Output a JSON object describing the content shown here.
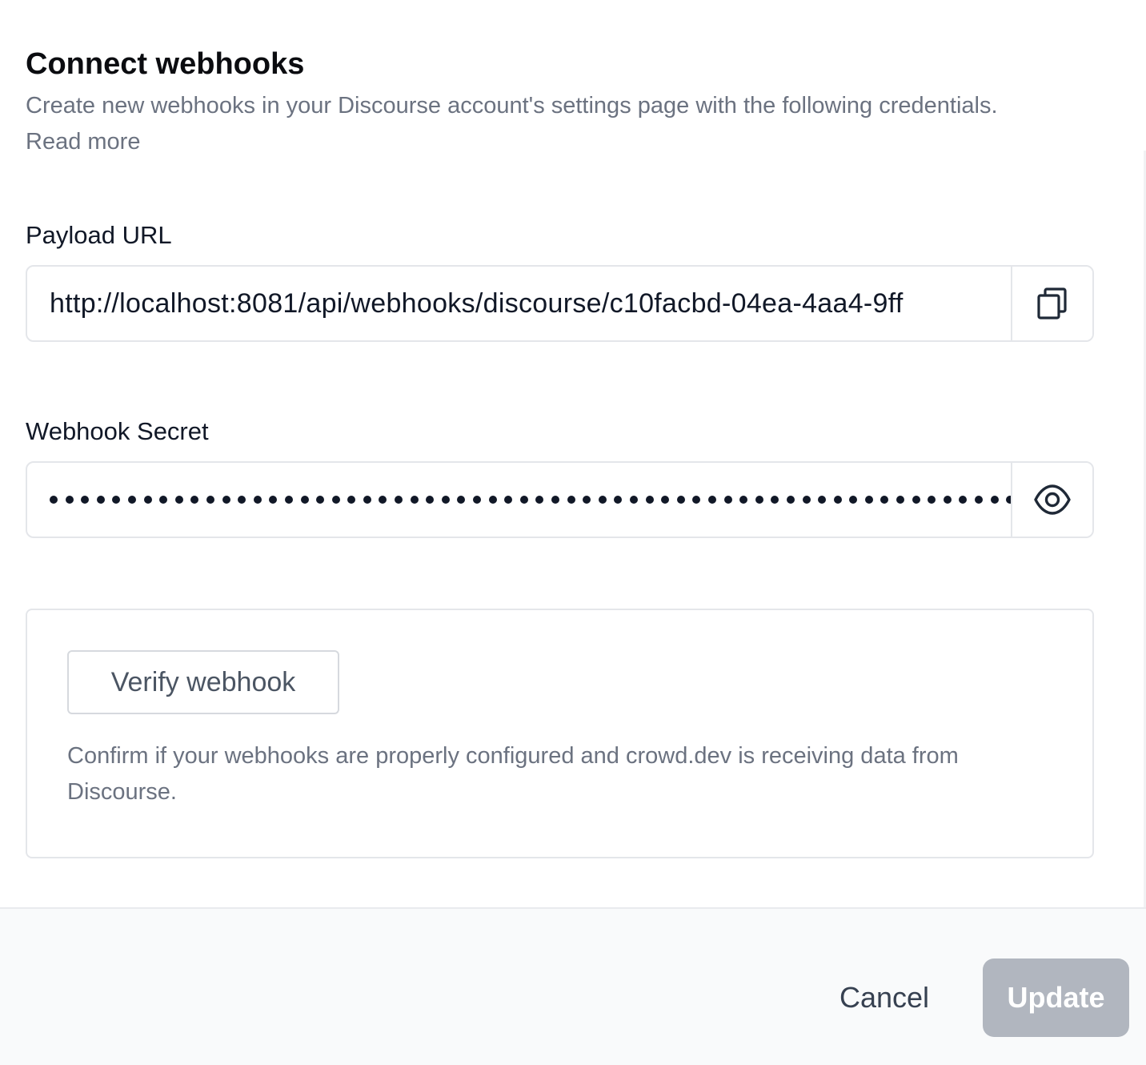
{
  "header": {
    "title": "Connect webhooks",
    "description": "Create new webhooks in your Discourse account's settings page with the following credentials.",
    "read_more": "Read more"
  },
  "payload_url": {
    "label": "Payload URL",
    "value": "http://localhost:8081/api/webhooks/discourse/c10facbd-04ea-4aa4-9ff",
    "copy_icon": "copy-icon"
  },
  "webhook_secret": {
    "label": "Webhook Secret",
    "masked": true,
    "visible_dot_count": 62,
    "toggle_icon": "eye-icon"
  },
  "verify": {
    "button_label": "Verify webhook",
    "help_text": "Confirm if your webhooks are properly configured and crowd.dev is receiving data from Discourse."
  },
  "footer": {
    "cancel_label": "Cancel",
    "update_label": "Update",
    "update_disabled": true
  },
  "colors": {
    "muted_text": "#6b7280",
    "border": "#e4e6ea",
    "footer_bg": "#f9fafb",
    "update_disabled_bg": "#b1b6bf"
  }
}
